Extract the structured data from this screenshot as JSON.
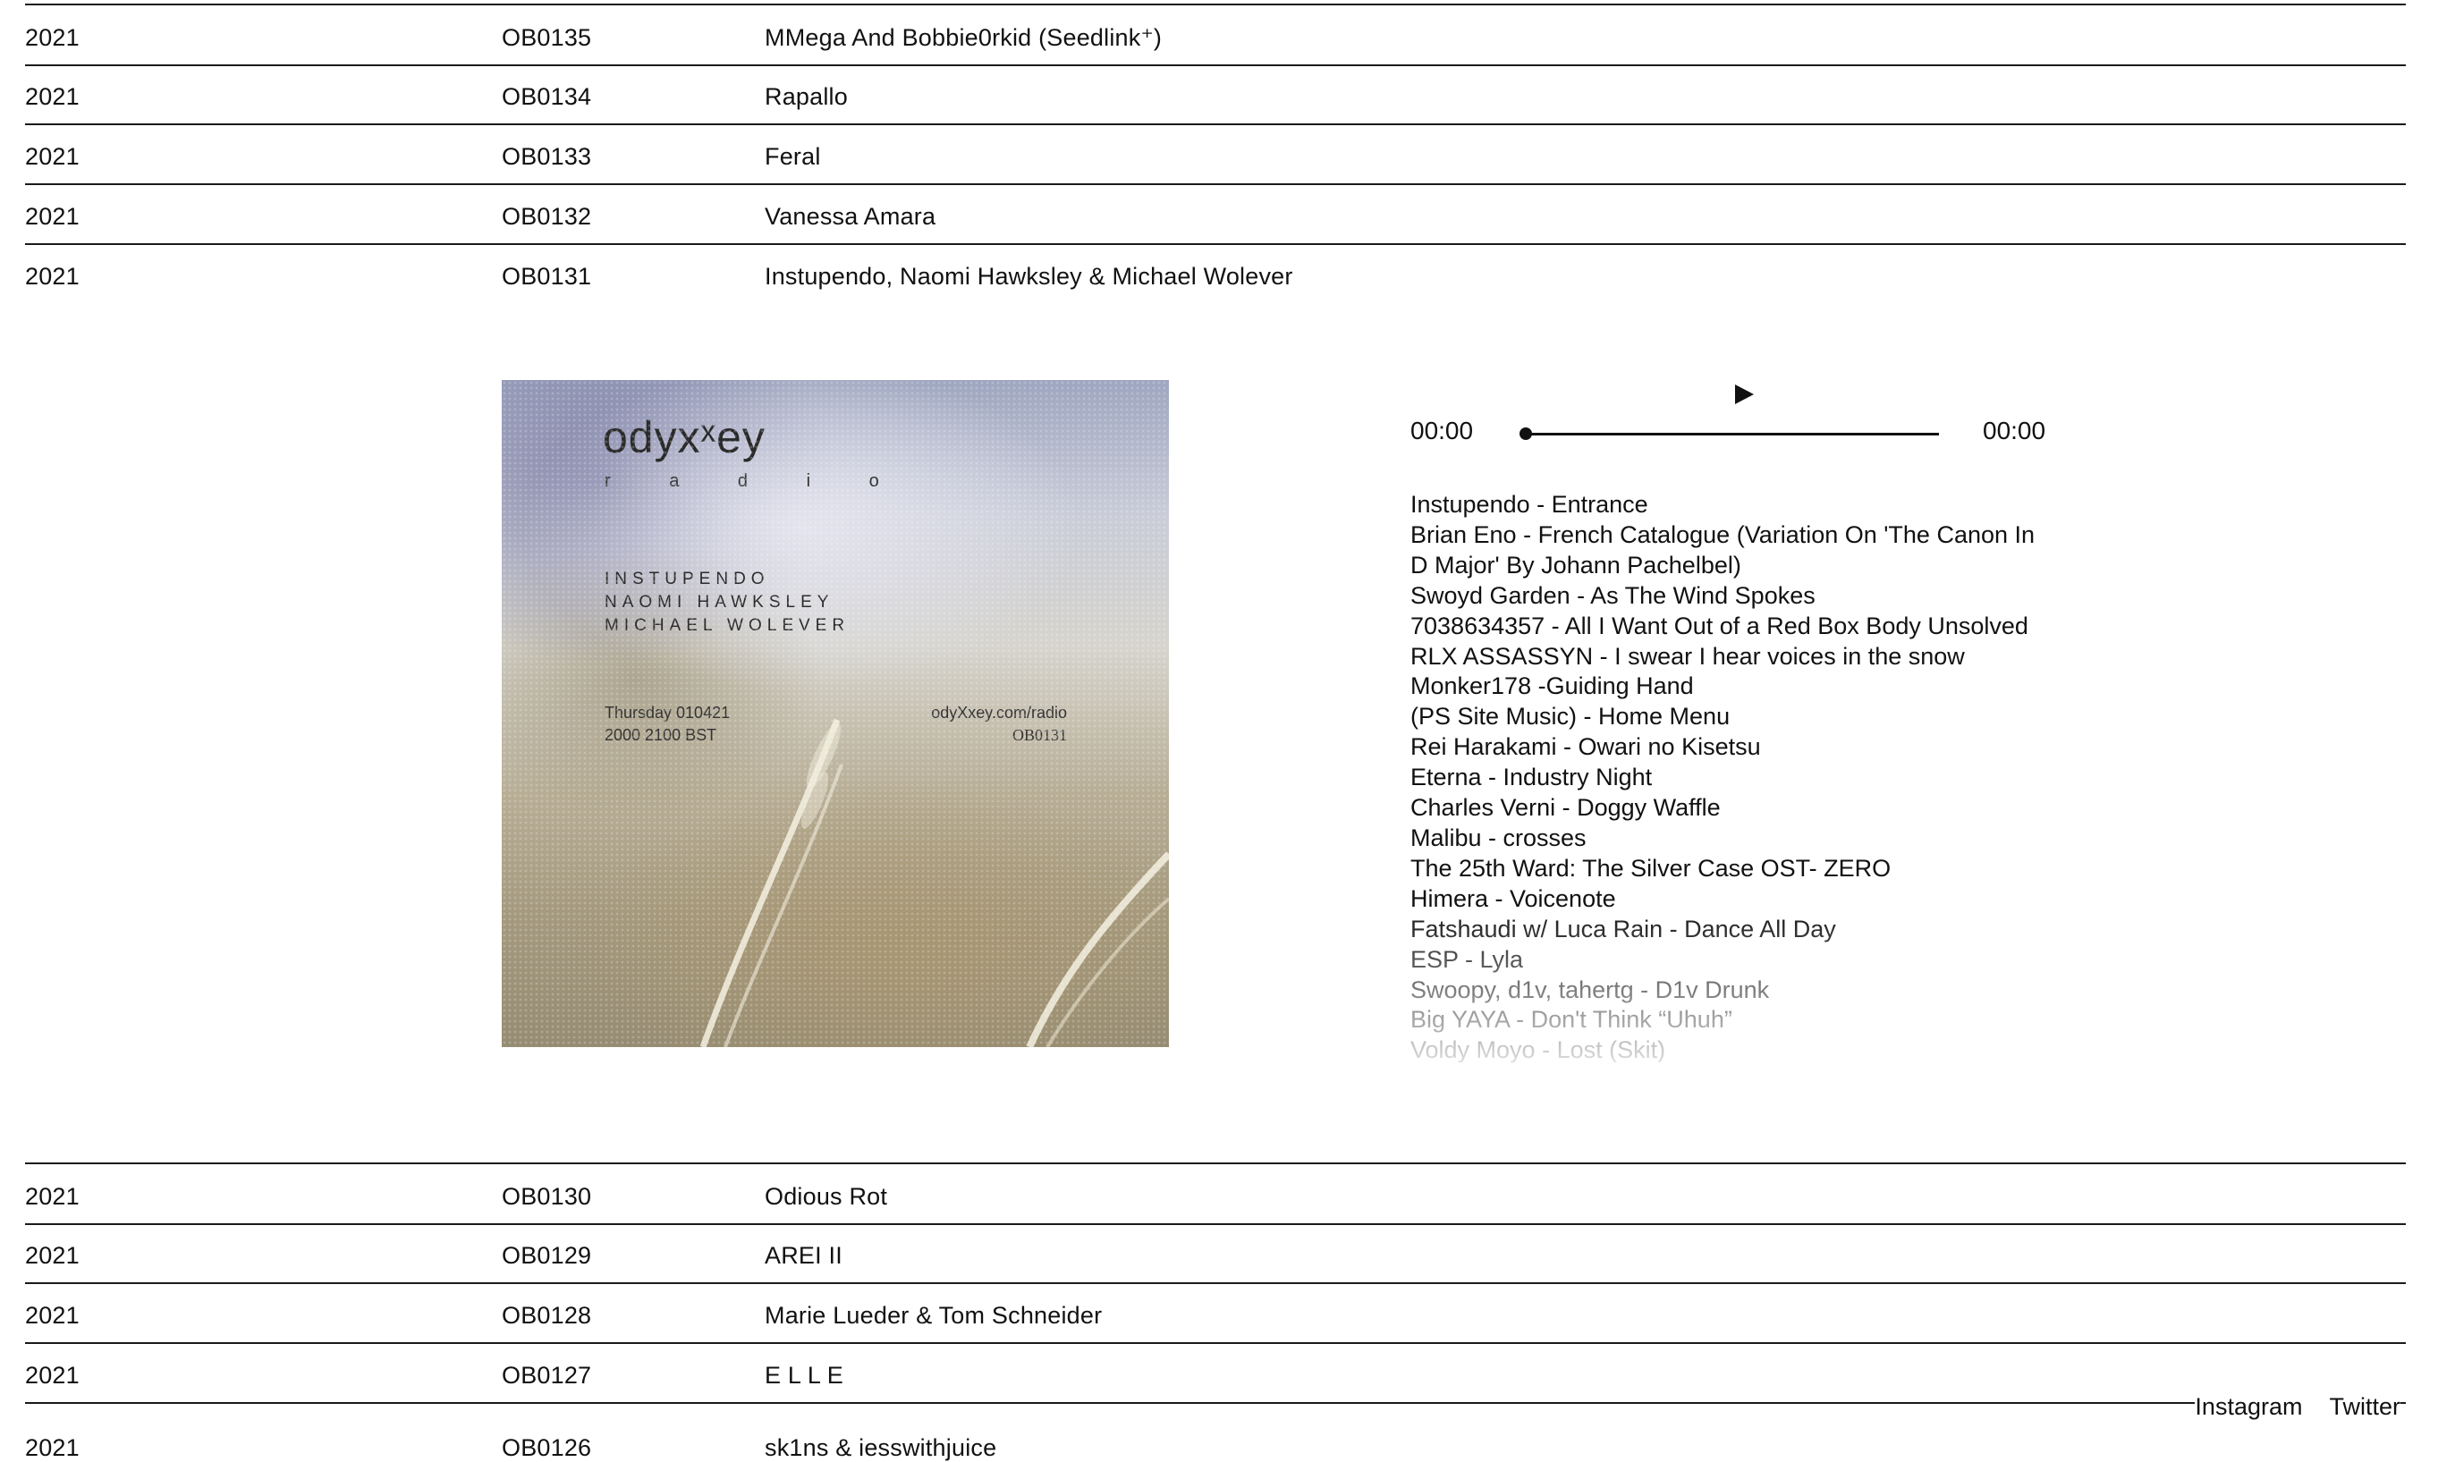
{
  "episodes_before": [
    {
      "year": "2021",
      "catalog": "OB0135",
      "title": "MMega And Bobbie0rkid (Seedlink⁺)"
    },
    {
      "year": "2021",
      "catalog": "OB0134",
      "title": "Rapallo"
    },
    {
      "year": "2021",
      "catalog": "OB0133",
      "title": "Feral"
    },
    {
      "year": "2021",
      "catalog": "OB0132",
      "title": "Vanessa Amara"
    },
    {
      "year": "2021",
      "catalog": "OB0131",
      "title": "Instupendo, Naomi Hawksley & Michael Wolever"
    }
  ],
  "expanded": {
    "artwork": {
      "logo": "odyxˣey",
      "sub": "r a d i o",
      "names": [
        "INSTUPENDO",
        "NAOMI HAWKSLEY",
        "MICHAEL WOLEVER"
      ],
      "date_line1": "Thursday 010421",
      "date_line2": "2000  2100 BST",
      "url": "odyXxey.com/radio",
      "catalog": "OB0131"
    },
    "player": {
      "play_icon": "play-icon",
      "time_current": "00:00",
      "time_total": "00:00",
      "progress": 0
    },
    "tracklist": [
      "Instupendo - Entrance",
      "Brian Eno - French Catalogue (Variation On 'The Canon In D Major' By Johann Pachelbel)",
      "Swoyd Garden - As The Wind Spokes",
      "7038634357 - All I Want Out of a Red Box Body Unsolved",
      "RLX ASSASSYN - I swear I hear voices in the snow",
      "Monker178 -Guiding Hand",
      "(PS Site Music) - Home Menu",
      "Rei Harakami - Owari no Kisetsu",
      "Eterna - Industry Night",
      "Charles Verni - Doggy Waffle",
      "Malibu - crosses",
      "The 25th Ward: The Silver Case OST- ZERO",
      "Himera - Voicenote",
      "Fatshaudi w/ Luca Rain - Dance All Day",
      "ESP - Lyla",
      "Swoopy, d1v, tahertg - D1v Drunk",
      "Big YAYA - Don't Think “Uhuh”",
      "Voldy Moyo - Lost (Skit)"
    ]
  },
  "episodes_after": [
    {
      "year": "2021",
      "catalog": "OB0130",
      "title": "Odious Rot"
    },
    {
      "year": "2021",
      "catalog": "OB0129",
      "title": "AREI II"
    },
    {
      "year": "2021",
      "catalog": "OB0128",
      "title": "Marie Lueder & Tom Schneider"
    },
    {
      "year": "2021",
      "catalog": "OB0127",
      "title": "E L L E"
    },
    {
      "year": "2021",
      "catalog": "OB0126",
      "title": "sk1ns & iesswithjuice"
    }
  ],
  "footer": {
    "instagram": "Instagram",
    "twitter": "Twitter"
  }
}
